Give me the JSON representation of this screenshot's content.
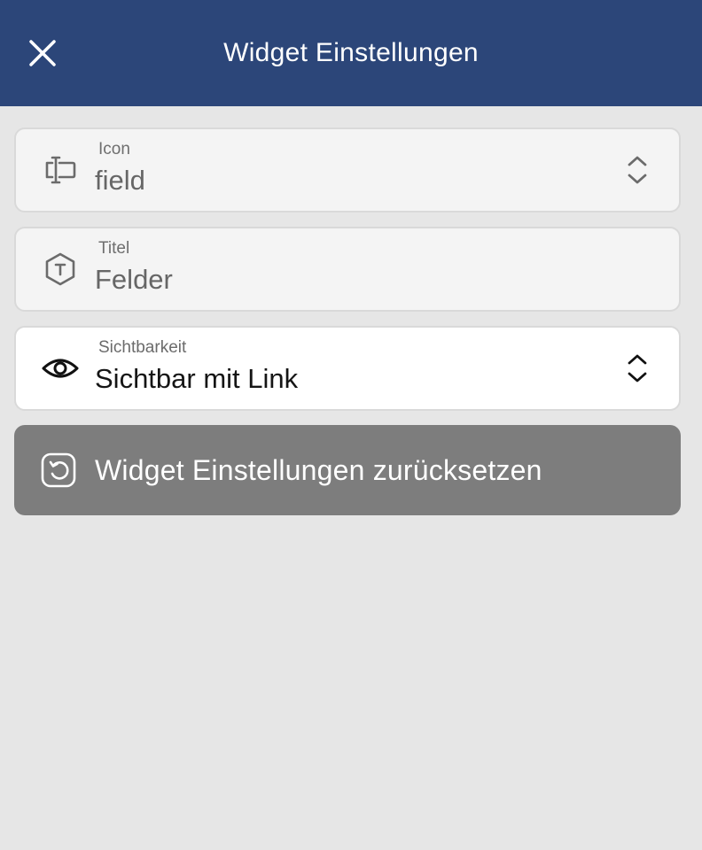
{
  "header": {
    "title": "Widget Einstellungen",
    "close_icon": "close-icon",
    "background": "#2c4679"
  },
  "fields": {
    "icon": {
      "label": "Icon",
      "value": "field",
      "icon": "field-icon",
      "control": "chevron-up-down-icon"
    },
    "title": {
      "label": "Titel",
      "value": "Felder",
      "icon": "text-hexagon-icon"
    },
    "visibility": {
      "label": "Sichtbarkeit",
      "value": "Sichtbar mit Link",
      "icon": "eye-icon",
      "control": "chevron-up-down-icon"
    }
  },
  "reset": {
    "label": "Widget Einstellungen zurücksetzen",
    "icon": "reset-icon",
    "background": "#7d7d7d"
  },
  "colors": {
    "page_background": "#e6e6e6",
    "card_background": "#f4f4f4",
    "card_active_background": "#ffffff",
    "card_border": "#d9d9d9"
  }
}
